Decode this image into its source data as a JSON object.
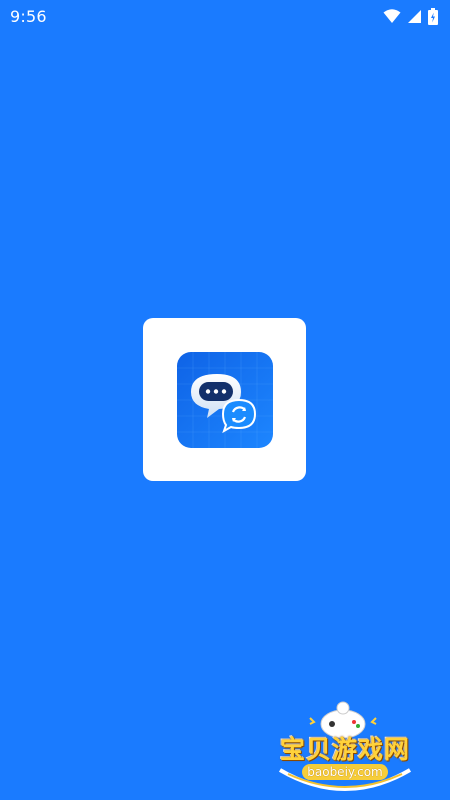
{
  "status_bar": {
    "time": "9:56",
    "icons": [
      "wifi-icon",
      "cell-signal-icon",
      "battery-icon"
    ]
  },
  "splash": {
    "logo": "chat-bot-sync-app-icon"
  },
  "watermark": {
    "title": "宝贝游戏网",
    "url": "baobeiy.com"
  },
  "colors": {
    "background": "#1a7bff",
    "card": "#ffffff",
    "icon_bg": "#1565e8",
    "watermark_gold": "#ffd23a"
  }
}
